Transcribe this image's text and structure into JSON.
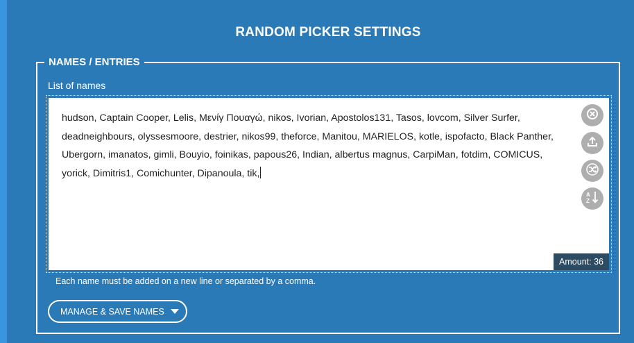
{
  "header": {
    "title": "RANDOM PICKER SETTINGS"
  },
  "section": {
    "legend": "NAMES / ENTRIES",
    "list_label": "List of names",
    "names_text": "hudson, Captain Cooper, Lelis, Μενίγ Πουαγώ, nikos, Ivorian, Apostolos131, Tasos, lovcom, Silver Surfer, deadneighbours, olyssesmoore, destrier, nikos99, theforce, Manitou, MARIELOS, kotle, ispofacto, Black Panther, Ubergorn, imanatos, gimli, Bouyio, foinikas, papous26, Indian, albertus magnus, CarpiMan, fotdim, COMICUS, yorick, Dimitris1, Comichunter, Dipanoula, tik,",
    "amount_label": "Amount:",
    "amount_value": "36",
    "helper_text": "Each name must be added on a new line or separated by a comma.",
    "manage_button": "MANAGE & SAVE NAMES"
  },
  "side_buttons": [
    {
      "icon": "clear-icon"
    },
    {
      "icon": "upload-icon"
    },
    {
      "icon": "shuffle-icon"
    },
    {
      "icon": "sort-az-icon"
    }
  ],
  "colors": {
    "background": "#2b7ab8",
    "left_strip": "#3a95e0",
    "icon_button": "#aeaeae",
    "amount_badge": "#2d4b63"
  }
}
